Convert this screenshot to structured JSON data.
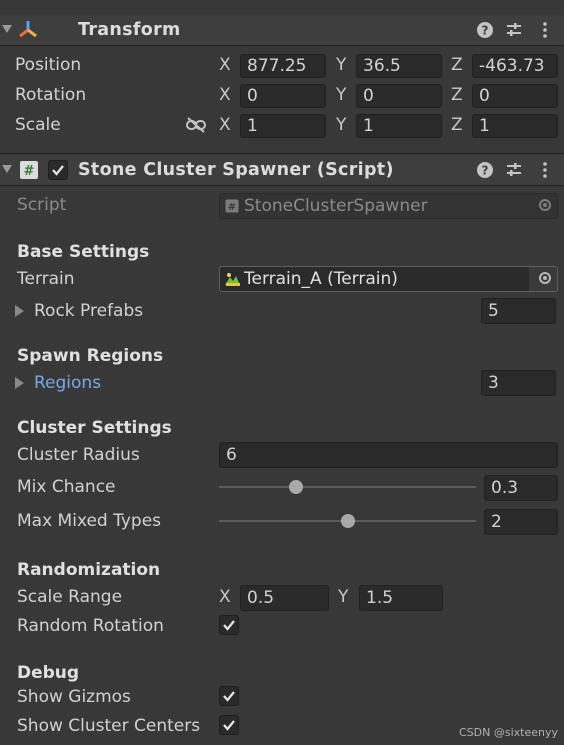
{
  "transform": {
    "title": "Transform",
    "position": {
      "label": "Position",
      "x": "877.25",
      "y": "36.5",
      "z": "-463.73"
    },
    "rotation": {
      "label": "Rotation",
      "x": "0",
      "y": "0",
      "z": "0"
    },
    "scale": {
      "label": "Scale",
      "x": "1",
      "y": "1",
      "z": "1"
    },
    "axis_x": "X",
    "axis_y": "Y",
    "axis_z": "Z"
  },
  "component": {
    "title": "Stone Cluster Spawner (Script)",
    "enabled": true,
    "script_label": "Script",
    "script_value": "StoneClusterSpawner"
  },
  "base_settings": {
    "header": "Base Settings",
    "terrain_label": "Terrain",
    "terrain_value": "Terrain_A (Terrain)",
    "rock_prefabs_label": "Rock Prefabs",
    "rock_prefabs_count": "5"
  },
  "spawn_regions": {
    "header": "Spawn Regions",
    "regions_label": "Regions",
    "regions_count": "3"
  },
  "cluster_settings": {
    "header": "Cluster Settings",
    "radius_label": "Cluster Radius",
    "radius_value": "6",
    "mix_chance_label": "Mix Chance",
    "mix_chance_value": "0.3",
    "mix_chance_fraction": 0.3,
    "max_mixed_label": "Max Mixed Types",
    "max_mixed_value": "2",
    "max_mixed_fraction": 0.5
  },
  "randomization": {
    "header": "Randomization",
    "scale_range_label": "Scale Range",
    "scale_x_label": "X",
    "scale_x": "0.5",
    "scale_y_label": "Y",
    "scale_y": "1.5",
    "random_rotation_label": "Random Rotation",
    "random_rotation": true
  },
  "debug": {
    "header": "Debug",
    "show_gizmos_label": "Show Gizmos",
    "show_gizmos": true,
    "show_centers_label": "Show Cluster Centers",
    "show_centers": true
  },
  "watermark": "CSDN @sixteenyy",
  "colors": {
    "link": "#7aa7e8",
    "panel": "#383838",
    "header": "#3e3e3e"
  }
}
